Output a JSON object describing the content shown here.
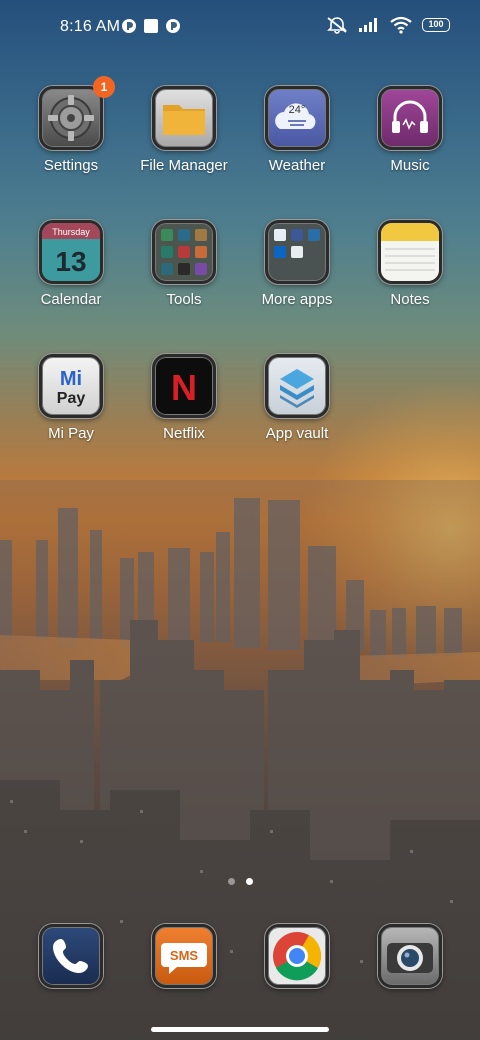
{
  "status_bar": {
    "time": "8:16 AM",
    "battery": "100",
    "icons": [
      "notification-app-icon",
      "notification-square-icon",
      "notification-app-icon",
      "mute-icon",
      "signal-icon",
      "wifi-icon",
      "battery-icon"
    ]
  },
  "apps": [
    {
      "label": "Settings",
      "icon": "settings-gear-icon",
      "badge": "1"
    },
    {
      "label": "File Manager",
      "icon": "folder-icon"
    },
    {
      "label": "Weather",
      "icon": "weather-cloud-icon",
      "temp": "24°"
    },
    {
      "label": "Music",
      "icon": "headphones-icon"
    },
    {
      "label": "Calendar",
      "icon": "calendar-icon",
      "weekday": "Thursday",
      "day": "13"
    },
    {
      "label": "Tools",
      "icon": "tools-folder-icon"
    },
    {
      "label": "More apps",
      "icon": "more-apps-folder-icon"
    },
    {
      "label": "Notes",
      "icon": "notes-icon"
    },
    {
      "label": "Mi Pay",
      "icon": "mi-pay-icon",
      "line1": "Mi",
      "line2": "Pay"
    },
    {
      "label": "Netflix",
      "icon": "netflix-icon",
      "letter": "N"
    },
    {
      "label": "App vault",
      "icon": "app-vault-icon"
    }
  ],
  "dock": [
    {
      "icon": "phone-icon"
    },
    {
      "icon": "sms-icon",
      "text": "SMS"
    },
    {
      "icon": "chrome-icon"
    },
    {
      "icon": "camera-icon"
    }
  ],
  "page_indicator": {
    "count": 2,
    "active": 2
  },
  "colors": {
    "badge": "#f26522",
    "label": "#ffffff"
  }
}
